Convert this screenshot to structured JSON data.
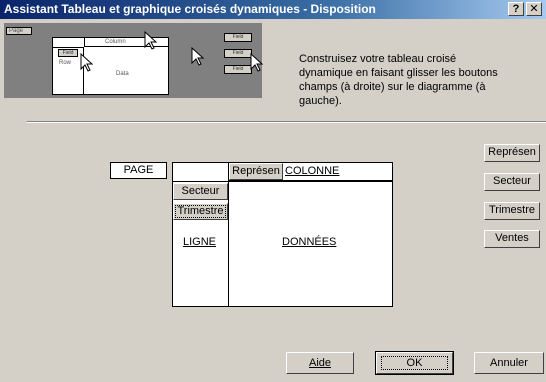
{
  "window": {
    "title": "Assistant Tableau et graphique croisés dynamiques - Disposition",
    "help_label": "?",
    "close_label": "✕"
  },
  "illustration": {
    "row_label": "Row",
    "col_label": "Column",
    "page_label": "Page",
    "data_label": "Data",
    "field1": "Field",
    "field2": "Field",
    "field3": "Field"
  },
  "instructions": "Construisez votre tableau croisé dynamique en faisant glisser les boutons champs (à droite) sur le diagramme (à gauche).",
  "pivot": {
    "page_area": "PAGE",
    "page_accel": "G",
    "column_area": "COLONNE",
    "row_area": "LIGNE",
    "data_area": "DONNÉES",
    "row_fields": [
      "Secteur",
      "Trimestre"
    ],
    "column_fields": [
      "Représen"
    ]
  },
  "field_list": [
    "Représen",
    "Secteur",
    "Trimestre",
    "Ventes"
  ],
  "buttons": {
    "help": "Aide",
    "ok": "OK",
    "cancel": "Annuler"
  }
}
